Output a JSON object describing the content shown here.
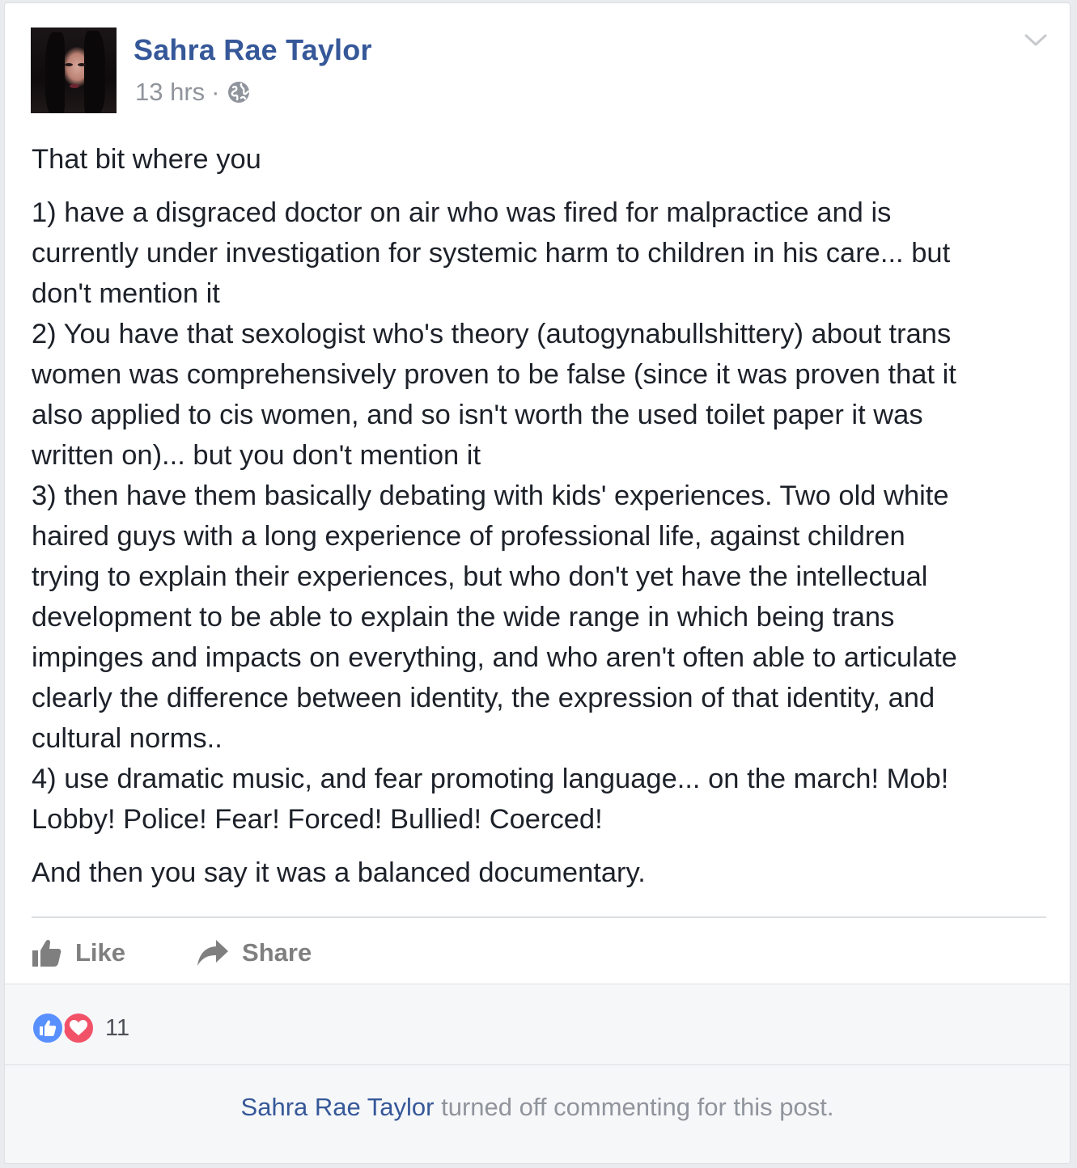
{
  "post": {
    "author": "Sahra Rae Taylor",
    "timestamp": "13 hrs",
    "separator": "·",
    "privacy_icon": "globe-icon",
    "menu_icon": "chevron-down-icon",
    "intro": "That bit where you",
    "lines": [
      "1) have a disgraced doctor on air who was fired for malpractice and is",
      "currently under investigation for systemic harm to children in his care... but",
      "don't mention it",
      "2) You have that sexologist who's theory (autogynabullshittery) about trans",
      "women was comprehensively proven to be false (since it was proven that it",
      "also applied to cis women, and so isn't worth the used toilet paper it was",
      "written on)... but you don't mention it",
      "3) then have them basically debating with kids' experiences. Two old white",
      "haired guys with a long experience of professional life, against children",
      "trying to explain their experiences, but who don't yet have the intellectual",
      "development to be able to explain the wide range in which being trans",
      "impinges and impacts on everything, and who aren't often able to articulate",
      "clearly the difference between identity, the expression of that identity, and",
      "cultural norms..",
      "4) use dramatic music, and fear promoting language... on the march! Mob!",
      "Lobby! Police! Fear! Forced! Bullied! Coerced!"
    ],
    "closing": "And then you say it was a balanced documentary."
  },
  "actions": {
    "like_label": "Like",
    "share_label": "Share"
  },
  "reactions": {
    "count": "11",
    "types": [
      "like",
      "love"
    ]
  },
  "comments_notice": {
    "name": "Sahra Rae Taylor",
    "text": " turned off commenting for this post."
  },
  "colors": {
    "link": "#365899",
    "meta": "#90949c",
    "text": "#1d2129",
    "like_reaction": "#5890ff",
    "love_reaction": "#f25268"
  }
}
